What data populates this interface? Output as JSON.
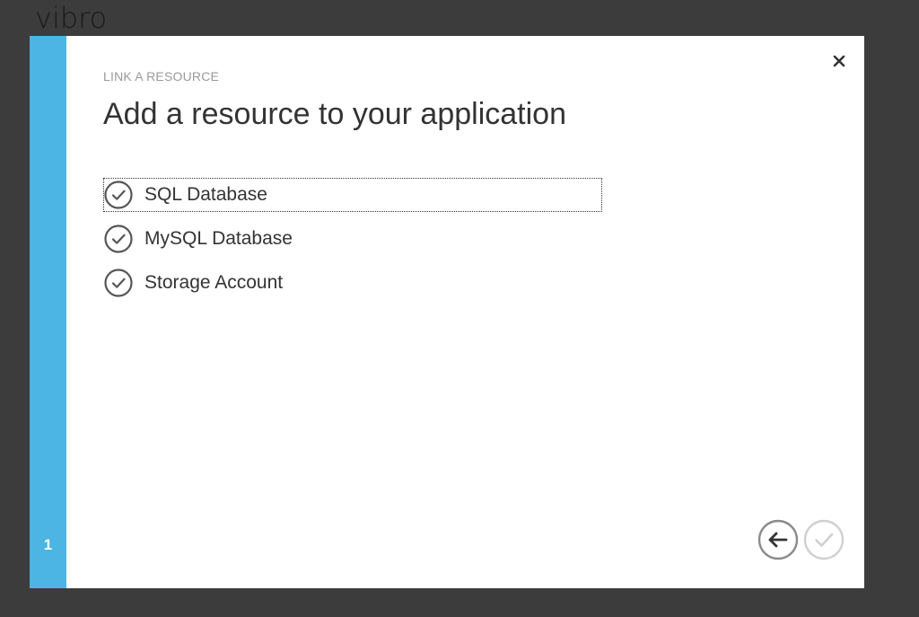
{
  "background": {
    "title": "vibro"
  },
  "dialog": {
    "kicker": "LINK A RESOURCE",
    "heading": "Add a resource to your application",
    "step": "1",
    "options": [
      {
        "label": "SQL Database",
        "focused": true
      },
      {
        "label": "MySQL Database",
        "focused": false
      },
      {
        "label": "Storage Account",
        "focused": false
      }
    ],
    "icons": {
      "close": "close-icon",
      "option": "checkmark-circle-icon",
      "back": "back-arrow-icon",
      "complete": "checkmark-icon"
    }
  },
  "colors": {
    "accent": "#4cb5e3",
    "backdrop": "#3c3c3c",
    "text": "#333333",
    "muted": "#9a9a9a",
    "disabled": "#d0d0d0"
  }
}
